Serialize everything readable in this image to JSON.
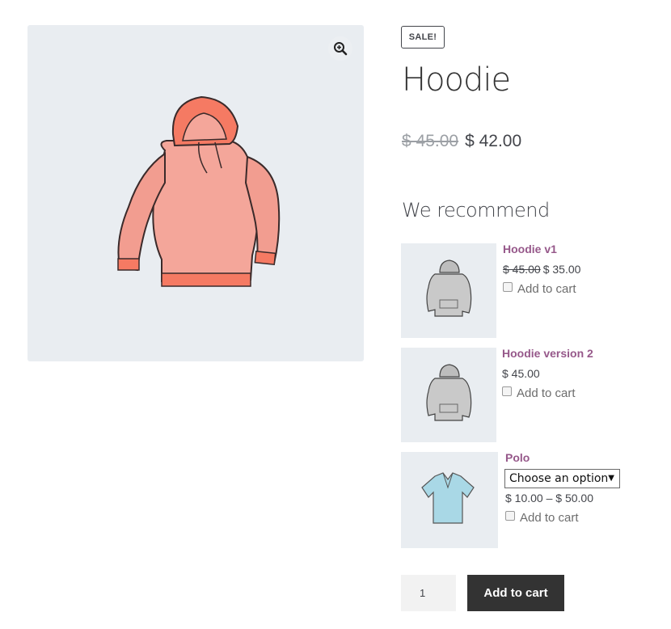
{
  "product": {
    "sale_badge": "SALE!",
    "title": "Hoodie",
    "old_price": "$ 45.00",
    "price": "$ 42.00",
    "image_icon": "hoodie-illustration-coral",
    "zoom_icon": "magnify-plus-icon"
  },
  "recommend": {
    "heading": "We recommend",
    "items": [
      {
        "name": "Hoodie v1",
        "old_price": "$ 45.00",
        "price": "$ 35.00",
        "add_label": "Add to cart",
        "icon": "hoodie-grey"
      },
      {
        "name": "Hoodie version 2",
        "price": "$ 45.00",
        "add_label": "Add to cart",
        "icon": "hoodie-grey"
      },
      {
        "name": "Polo",
        "select_value": "Choose an option",
        "price": "$ 10.00 – $ 50.00",
        "add_label": "Add to cart",
        "icon": "polo-blue"
      }
    ]
  },
  "cart": {
    "quantity": "1",
    "button_label": "Add to cart"
  },
  "colors": {
    "accent": "#96588a",
    "button": "#333333",
    "image_bg": "#e9edf1",
    "hoodie": "#f4a69a",
    "polo": "#a9d8e6"
  }
}
